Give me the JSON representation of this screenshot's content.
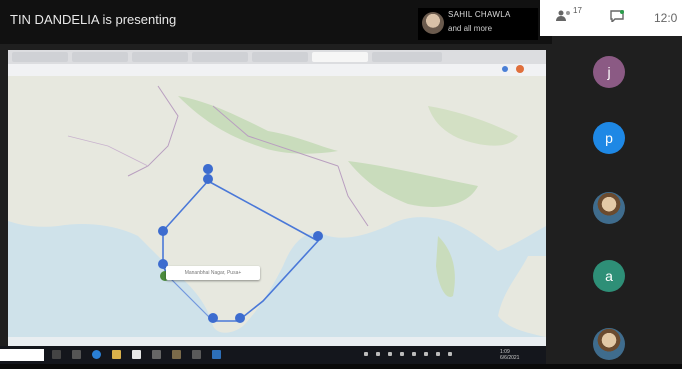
{
  "meeting": {
    "presenter_banner": "TIN DANDELIA is presenting",
    "participant_chip": {
      "name": "SAHIL CHAWLA",
      "more": "and all more"
    },
    "top_icons": {
      "participants_icon": "people-icon",
      "participants_count": "17",
      "chat_icon": "chat-icon"
    },
    "clock": "12:0"
  },
  "shared_screen": {
    "map_popup_text": "Mananbhai Nagar, Pusa+",
    "route_colour": "#4a78d8"
  },
  "participants": [
    {
      "kind": "letter",
      "letter": "j",
      "color": "#8b5a84"
    },
    {
      "kind": "letter",
      "letter": "p",
      "color": "#1e88e5"
    },
    {
      "kind": "photo"
    },
    {
      "kind": "letter",
      "letter": "a",
      "color": "#2e8f77"
    },
    {
      "kind": "photo"
    }
  ],
  "taskbar": {
    "time": "1:09",
    "date": "6/6/2021"
  }
}
